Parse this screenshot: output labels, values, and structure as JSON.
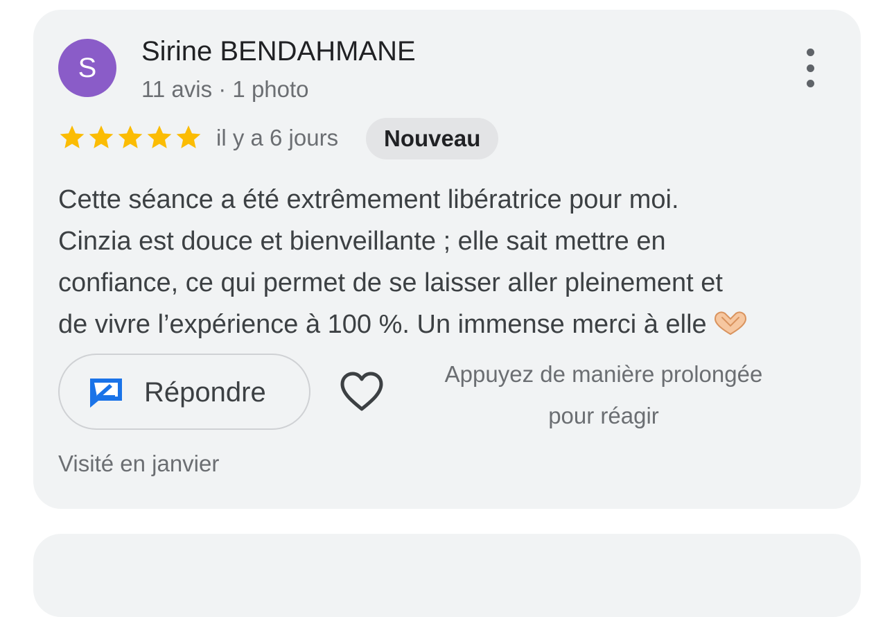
{
  "review": {
    "author": {
      "initial": "S",
      "name": "Sirine BENDAHMANE",
      "meta": "11 avis · 1 photo",
      "avatar_color": "#8a5cc8"
    },
    "menu_icon": "more-vertical-icon",
    "rating": 5,
    "rating_max": 5,
    "star_color": "#fbbc04",
    "time_ago": "il y a 6 jours",
    "badge": "Nouveau",
    "text_lines": [
      "Cette séance a été extrêmement libératrice pour moi.",
      "Cinzia est douce et bienveillante ; elle sait mettre en",
      "confiance, ce qui permet de se laisser aller pleinement et",
      "de vivre l’expérience à 100 %. Un immense merci à elle"
    ],
    "text_trailing_icon": "heart-hands-emoji-icon",
    "actions": {
      "reply_label": "Répondre",
      "reply_icon": "reply-icon",
      "reply_icon_color": "#1a73e8",
      "like_icon": "heart-outline-icon",
      "react_hint_lines": [
        "Appuyez de manière prolongée",
        "pour réagir"
      ]
    },
    "visited": "Visité en janvier"
  }
}
